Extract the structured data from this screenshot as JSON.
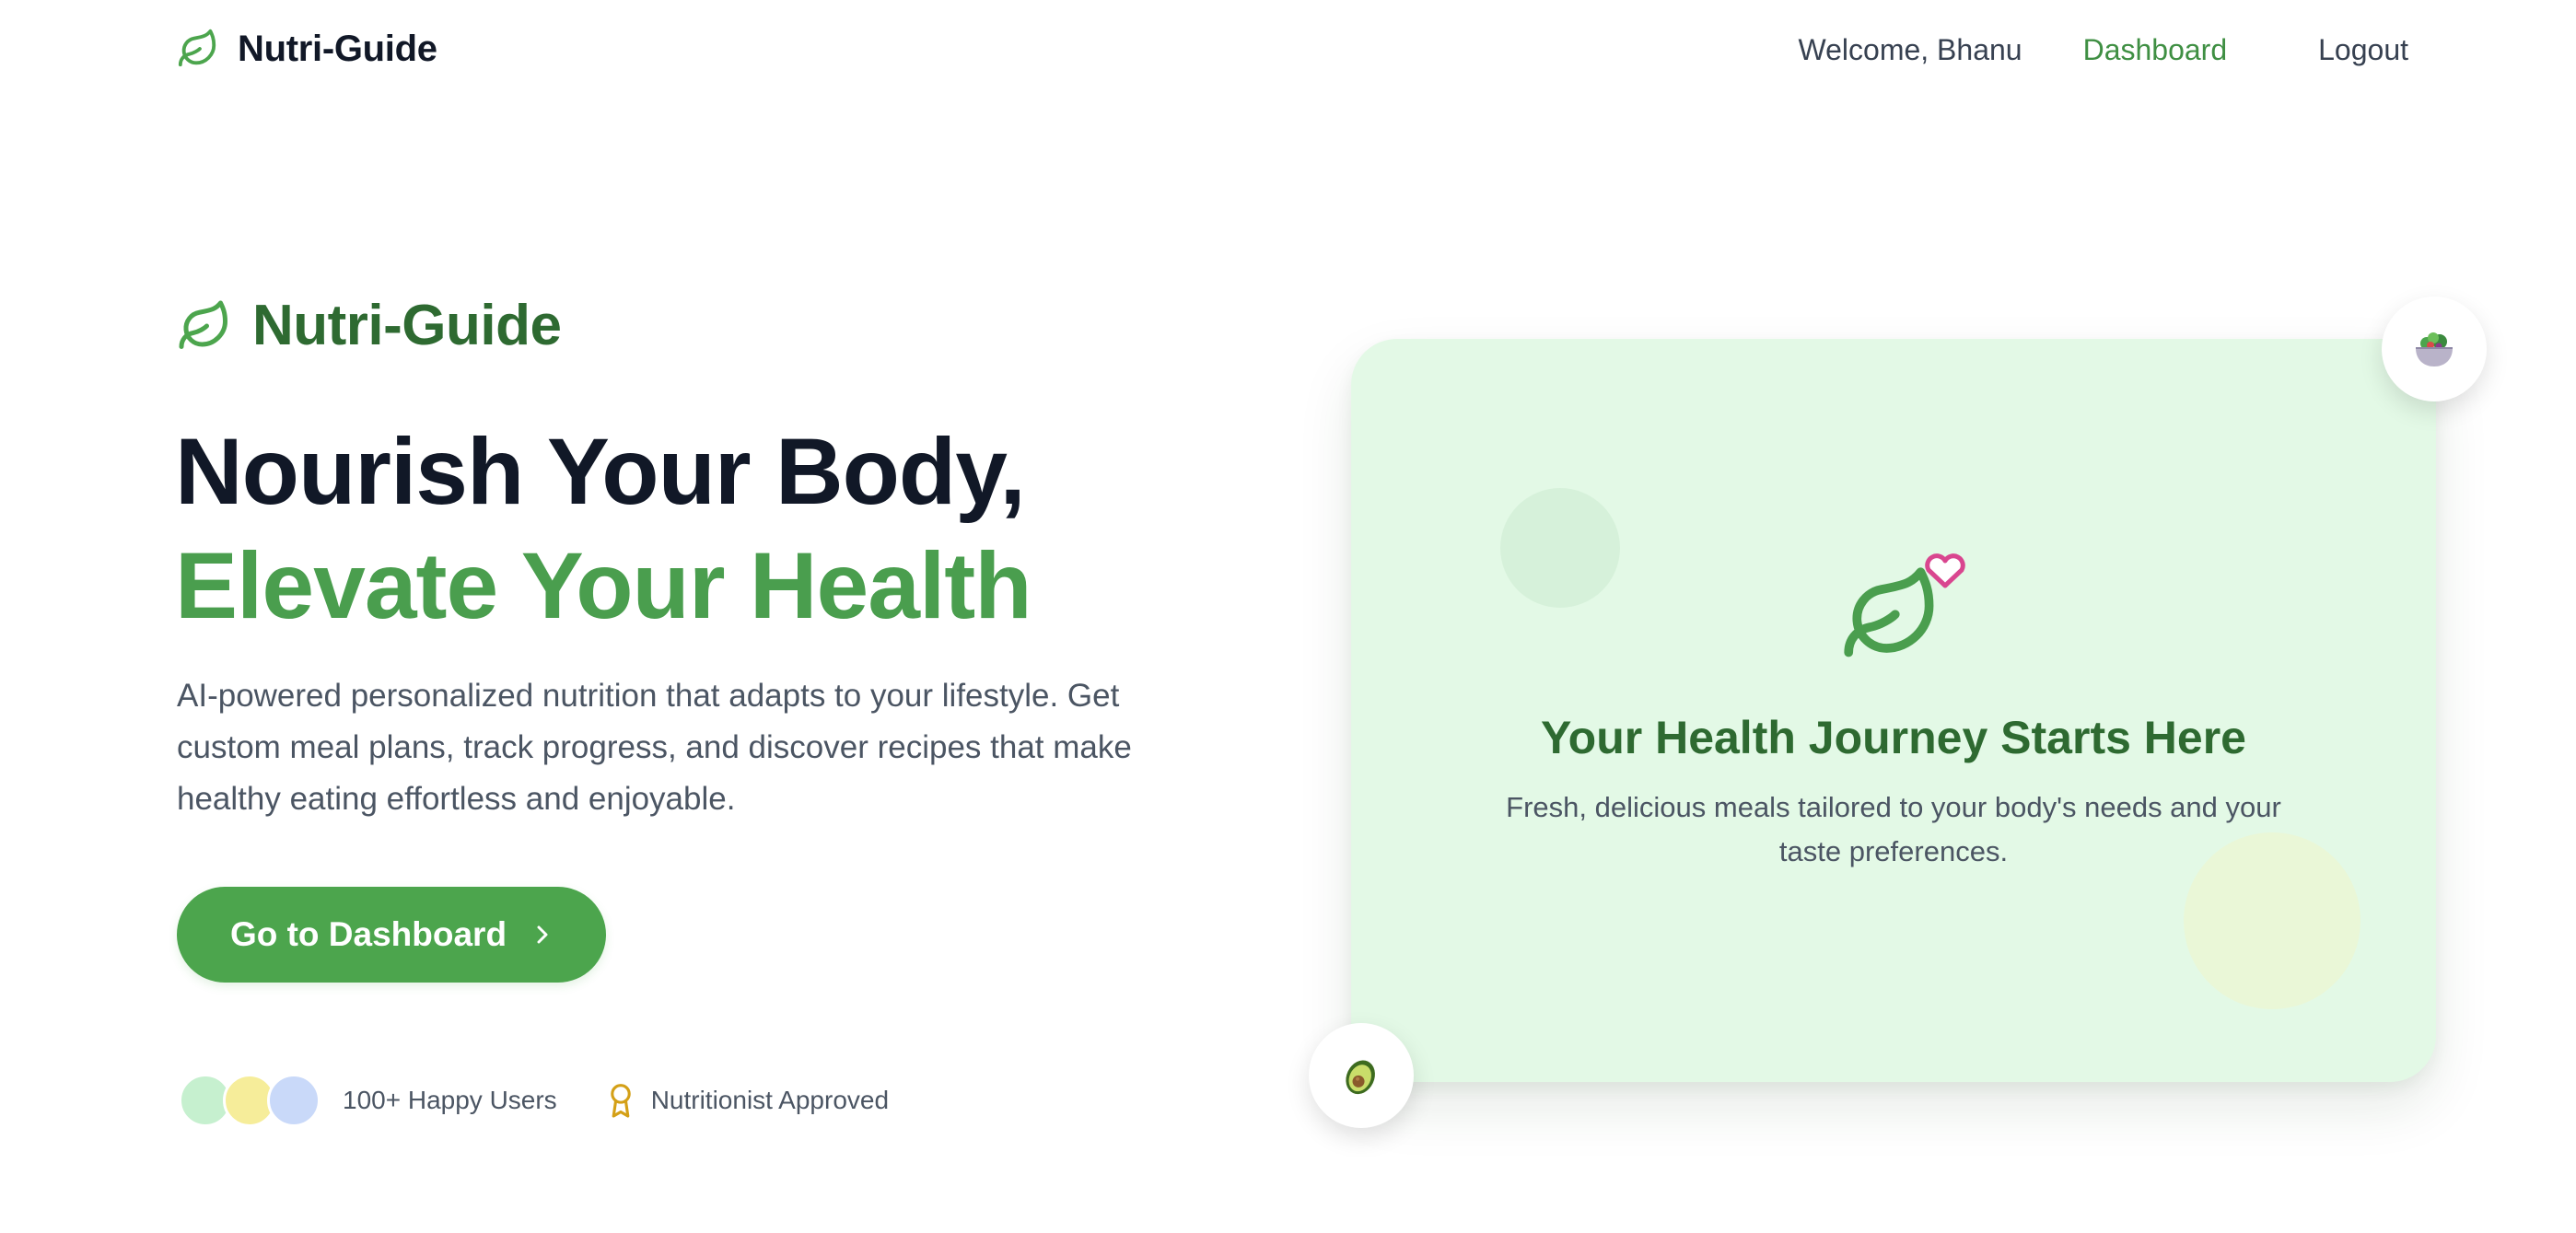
{
  "nav": {
    "brand": "Nutri-Guide",
    "welcome": "Welcome, Bhanu",
    "dashboard": "Dashboard",
    "logout": "Logout"
  },
  "hero": {
    "brand": "Nutri-Guide",
    "headline_line1": "Nourish Your Body,",
    "headline_line2": "Elevate Your Health",
    "description": "AI-powered personalized nutrition that adapts to your lifestyle. Get custom meal plans, track progress, and discover recipes that make healthy eating effortless and enjoyable.",
    "cta_label": "Go to Dashboard",
    "happy_users": "100+ Happy Users",
    "approved": "Nutritionist Approved"
  },
  "card": {
    "title": "Your Health Journey Starts Here",
    "subtitle": "Fresh, delicious meals tailored to your body's needs and your taste preferences."
  },
  "icons": {
    "brand": "leaf-icon",
    "cta": "chevron-right-icon",
    "award": "award-icon",
    "card": "leaf-heart-icon",
    "badge_top": "salad-bowl-icon",
    "badge_bottom": "avocado-icon"
  },
  "colors": {
    "primary_green": "#4ca54d",
    "dark_green": "#2e6a31",
    "headline_dark": "#111827",
    "card_background": "#e3f9e6",
    "heart_pink": "#d9468f",
    "award_gold": "#d4a017"
  }
}
